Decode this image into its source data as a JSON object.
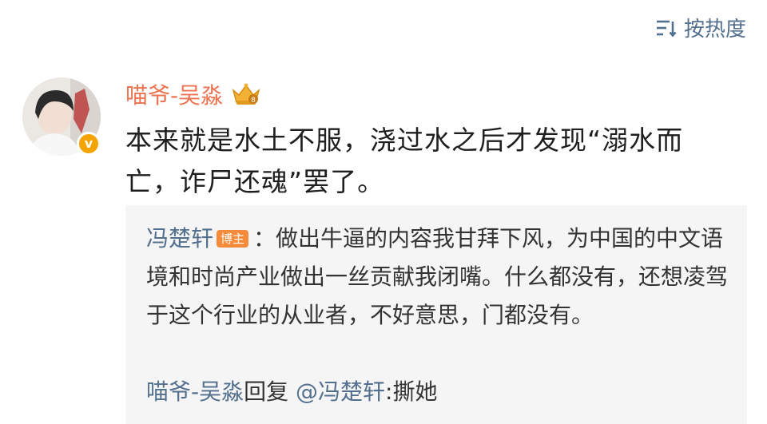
{
  "sort": {
    "icon": "sort-lines-icon",
    "label": "按热度"
  },
  "comment": {
    "author": "喵爷-吴淼",
    "avatar": "user-avatar",
    "badge_icon": "crown-level-icon",
    "verified_icon": "v-verified-icon",
    "verified_mark": "v",
    "text": "本来就是水土不服，浇过水之后才发现“溺水而\n亡，诈尸还魂”罢了。"
  },
  "quoted_reply": {
    "user": "冯楚轩",
    "tag": "博主",
    "separator": "：",
    "text": "做出牛逼的内容我甘拜下风，为中国的中文语境和时尚产业做出一丝贡献我闭嘴。什么都没有，还想凌驾于这个行业的从业者，不好意思，门都没有。"
  },
  "reply_line": {
    "author": "喵爷-吴淼",
    "action": "回复",
    "mention": "@冯楚轩",
    "colon": ":",
    "text": "撕她"
  },
  "colors": {
    "author": "#eb7350",
    "link": "#54708f",
    "reply_bg": "#f5f5f5",
    "tag_bg": "#f58b3a"
  }
}
